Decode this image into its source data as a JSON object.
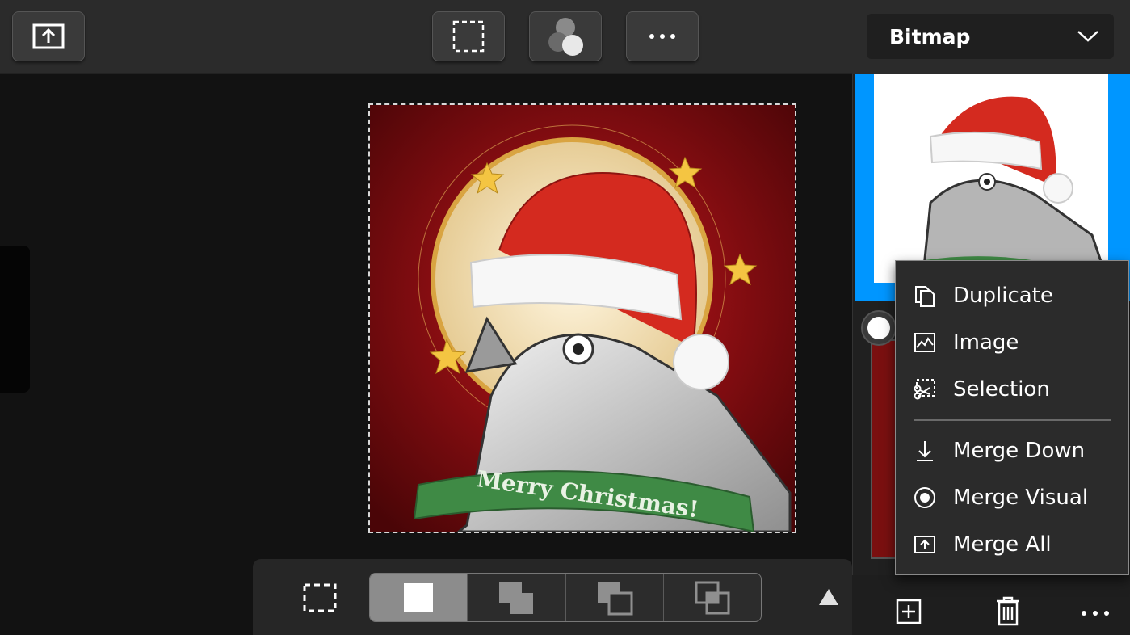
{
  "layer_type": {
    "selected": "Bitmap"
  },
  "artwork": {
    "banner_text": "Merry Christmas!"
  },
  "context_menu": {
    "items": [
      {
        "label": "Duplicate",
        "icon": "duplicate-icon"
      },
      {
        "label": "Image",
        "icon": "image-icon"
      },
      {
        "label": "Selection",
        "icon": "selection-cut-icon"
      },
      {
        "label": "Merge Down",
        "icon": "merge-down-icon"
      },
      {
        "label": "Merge Visual",
        "icon": "merge-visual-icon"
      },
      {
        "label": "Merge All",
        "icon": "merge-all-icon"
      }
    ]
  },
  "colors": {
    "accent": "#0096ff",
    "toolbar": "#2b2b2b",
    "canvas_bg": "#121212",
    "menu_bg": "#2b2b2b"
  }
}
